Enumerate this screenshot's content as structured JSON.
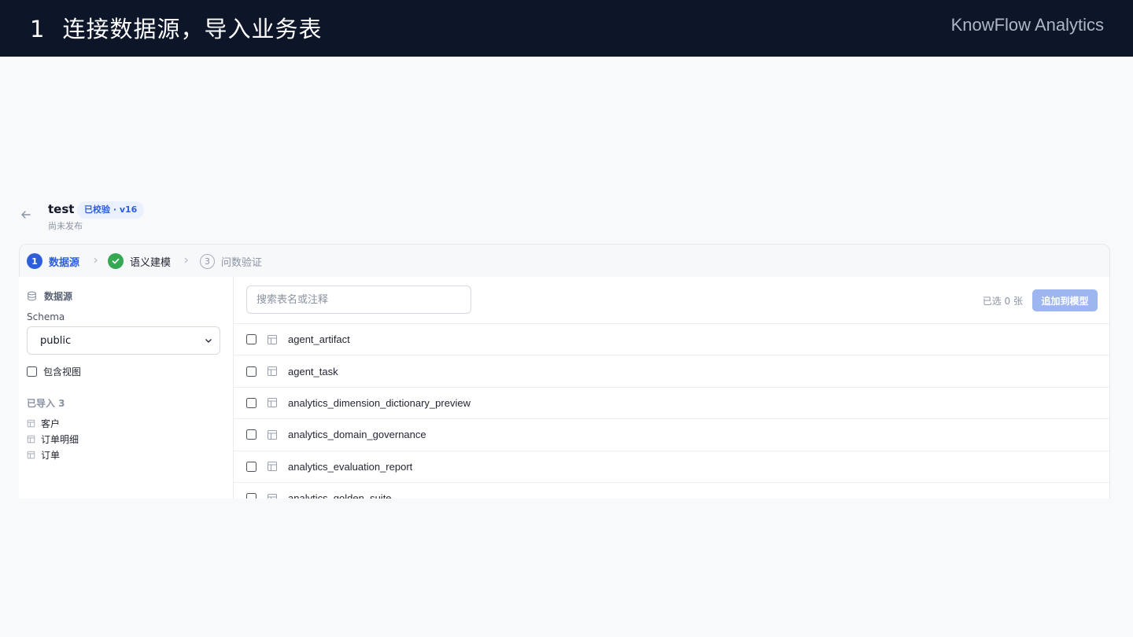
{
  "slide": {
    "step_number": "1",
    "step_title": "连接数据源，导入业务表",
    "brand": "KnowFlow Analytics"
  },
  "header": {
    "title": "test",
    "badge": "已校验 · v16",
    "subtitle": "尚未发布"
  },
  "stepper": {
    "steps": [
      {
        "index": "1",
        "label": "数据源",
        "state": "active"
      },
      {
        "index": "✓",
        "label": "语义建模",
        "state": "done"
      },
      {
        "index": "3",
        "label": "问数验证",
        "state": "pending"
      }
    ]
  },
  "sidebar": {
    "title": "数据源",
    "schema_label": "Schema",
    "schema_value": "public",
    "include_views_label": "包含视图",
    "include_views_checked": false,
    "imported_title": "已导入 3",
    "imported_tables": [
      "客户",
      "订单明细",
      "订单"
    ]
  },
  "table_picker": {
    "search_placeholder": "搜索表名或注释",
    "search_value": "",
    "selected_count": "已选 0 张",
    "add_button": "追加到模型",
    "tables": [
      "agent_artifact",
      "agent_task",
      "analytics_dimension_dictionary_preview",
      "analytics_domain_governance",
      "analytics_evaluation_report",
      "analytics_golden_suite"
    ]
  },
  "colors": {
    "topbar_bg": "#0d1629",
    "accent": "#2f5fd8",
    "success": "#34a853",
    "button_disabled": "#9db6ef"
  }
}
